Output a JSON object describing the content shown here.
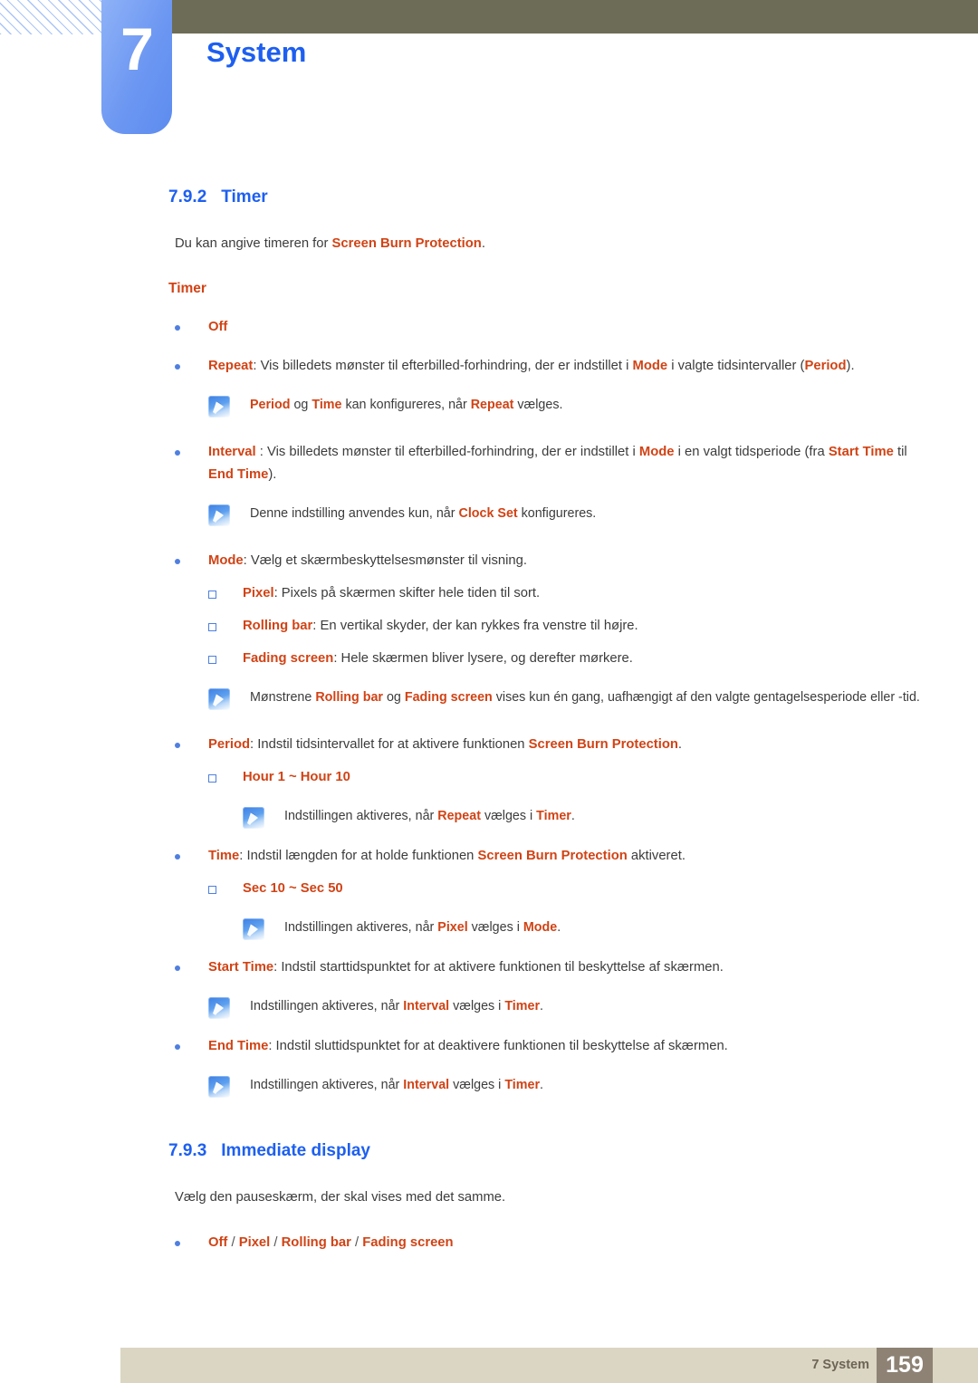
{
  "header": {
    "chapter_number": "7",
    "chapter_title": "System",
    "band_color": "#6d6c56",
    "tab_color": "#6c97f2",
    "title_color": "#1d5ff0"
  },
  "colors": {
    "heading_blue": "#1d5ff0",
    "term_orange": "#d14315",
    "body_gray": "#3c3c3c",
    "footer_bar": "#dbd5c3",
    "footer_page_box": "#8d8274"
  },
  "section_timer": {
    "number": "7.9.2",
    "title": "Timer",
    "intro_pre": "Du kan angive timeren for ",
    "intro_term": "Screen Burn Protection",
    "intro_post": ".",
    "subhead": "Timer",
    "b_off": "Off",
    "b_repeat_term": "Repeat",
    "b_repeat_text": ": Vis billedets mønster til efterbilled-forhindring, der er indstillet i ",
    "b_repeat_term2": "Mode",
    "b_repeat_text2": " i valgte tidsintervaller (",
    "b_repeat_term3": "Period",
    "b_repeat_text3": ").",
    "note1_t1": "Period",
    "note1_x1": " og ",
    "note1_t2": "Time",
    "note1_x2": " kan konfigureres, når ",
    "note1_t3": "Repeat",
    "note1_x3": " vælges.",
    "b_interval_term": "Interval",
    "b_interval_text": " : Vis billedets mønster til efterbilled-forhindring, der er indstillet i ",
    "b_interval_term2": "Mode",
    "b_interval_text2": " i en valgt tidsperiode (fra ",
    "b_interval_term3": "Start Time",
    "b_interval_text3": " til ",
    "b_interval_term4": "End Time",
    "b_interval_text4": ").",
    "note2_x1": "Denne indstilling anvendes kun, når ",
    "note2_t1": "Clock Set",
    "note2_x2": " konfigureres.",
    "b_mode_term": "Mode",
    "b_mode_text": ": Vælg et skærmbeskyttelsesmønster til visning.",
    "b_pixel_term": "Pixel",
    "b_pixel_text": ": Pixels på skærmen skifter hele tiden til sort.",
    "b_rolling_term": "Rolling bar",
    "b_rolling_text": ": En vertikal skyder, der kan rykkes fra venstre til højre.",
    "b_fading_term": "Fading screen",
    "b_fading_text": ": Hele skærmen bliver lysere, og derefter mørkere.",
    "note3_x1": "Mønstrene ",
    "note3_t1": "Rolling bar",
    "note3_x2": " og ",
    "note3_t2": "Fading screen",
    "note3_x3": " vises kun én gang, uafhængigt af den valgte gentagelsesperiode eller -tid.",
    "b_period_term": "Period",
    "b_period_text": ": Indstil tidsintervallet for at aktivere funktionen ",
    "b_period_term2": "Screen Burn Protection",
    "b_period_text2": ".",
    "b_hour_range": "Hour 1 ~ Hour 10",
    "note4_x1": "Indstillingen aktiveres, når ",
    "note4_t1": "Repeat",
    "note4_x2": " vælges i ",
    "note4_t2": "Timer",
    "note4_x3": ".",
    "b_time_term": "Time",
    "b_time_text": ": Indstil længden for at holde funktionen ",
    "b_time_term2": "Screen Burn Protection",
    "b_time_text2": " aktiveret.",
    "b_sec_range": "Sec 10 ~ Sec 50",
    "note5_x1": "Indstillingen aktiveres, når ",
    "note5_t1": "Pixel",
    "note5_x2": " vælges i ",
    "note5_t2": "Mode",
    "note5_x3": ".",
    "b_start_term": "Start Time",
    "b_start_text": ": Indstil starttidspunktet for at aktivere funktionen til beskyttelse af skærmen.",
    "note6_x1": "Indstillingen aktiveres, når ",
    "note6_t1": "Interval",
    "note6_x2": " vælges i ",
    "note6_t2": "Timer",
    "note6_x3": ".",
    "b_end_term": "End Time",
    "b_end_text": ": Indstil sluttidspunktet for at deaktivere funktionen til beskyttelse af skærmen.",
    "note7_x1": "Indstillingen aktiveres, når ",
    "note7_t1": "Interval",
    "note7_x2": " vælges i ",
    "note7_t2": "Timer",
    "note7_x3": "."
  },
  "section_immediate": {
    "number": "7.9.3",
    "title": "Immediate display",
    "intro": "Vælg den pauseskærm, der skal vises med det samme.",
    "opt1": "Off",
    "sep1": " / ",
    "opt2": "Pixel",
    "sep2": " / ",
    "opt3": "Rolling bar",
    "sep3": " / ",
    "opt4": "Fading screen"
  },
  "footer": {
    "label": "7 System",
    "page_number": "159"
  }
}
